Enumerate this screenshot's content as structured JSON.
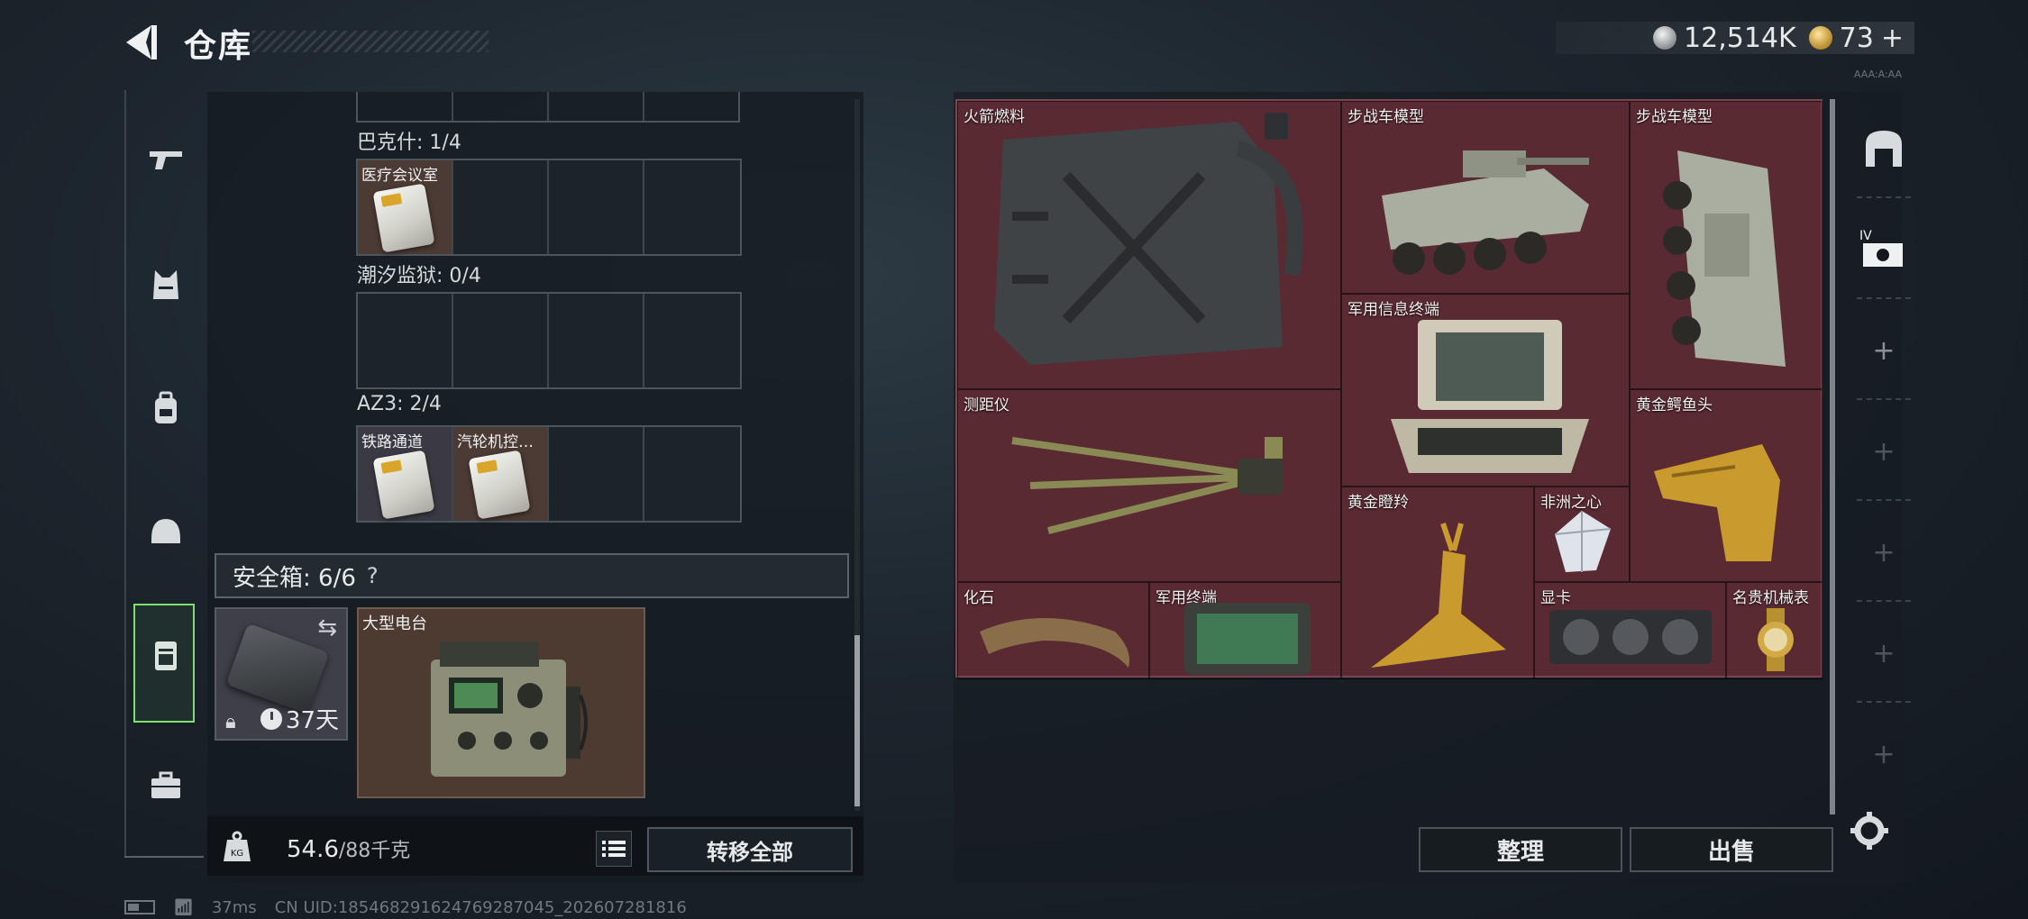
{
  "header": {
    "title": "仓库",
    "currency": {
      "silver_value": "12,514K",
      "gold_value": "73",
      "add_symbol": "+"
    },
    "tiny_code": "AAA:A:AA"
  },
  "left_rail": {
    "items": [
      {
        "name": "weapons",
        "icon": "pistol-icon"
      },
      {
        "name": "armor",
        "icon": "vest-icon"
      },
      {
        "name": "backpack",
        "icon": "backpack-icon"
      },
      {
        "name": "helmet",
        "icon": "helmet-icon"
      },
      {
        "name": "safe-case",
        "icon": "safe-case-icon",
        "active": true
      },
      {
        "name": "toolkit",
        "icon": "briefcase-icon"
      }
    ]
  },
  "keycard_sections": [
    {
      "label": "巴克什: 1/4",
      "cells": [
        "医疗会议室",
        "",
        "",
        ""
      ]
    },
    {
      "label": "潮汐监狱: 0/4",
      "cells": [
        "",
        "",
        "",
        ""
      ]
    },
    {
      "label": "AZ3: 2/4",
      "cells": [
        "铁路通道",
        "汽轮机控…",
        "",
        ""
      ]
    }
  ],
  "safe_box": {
    "header": "安全箱: 6/6",
    "help": "?",
    "swap_icon": "swap-icon",
    "lock_icon": "lock-icon",
    "timer": "37天",
    "stored_item": "大型电台"
  },
  "weight": {
    "current": "54.6",
    "max": "/88千克",
    "icon": "kg-weight-icon"
  },
  "buttons": {
    "transfer_all": "转移全部",
    "sort": "整理",
    "sell": "出售"
  },
  "storage_items": [
    {
      "label": "火箭燃料"
    },
    {
      "label": "步战车模型"
    },
    {
      "label": "步战车模型"
    },
    {
      "label": "军用信息终端"
    },
    {
      "label": "测距仪"
    },
    {
      "label": "黄金鳄鱼头"
    },
    {
      "label": "黄金瞪羚"
    },
    {
      "label": "非洲之心"
    },
    {
      "label": "化石"
    },
    {
      "label": "军用终端"
    },
    {
      "label": "显卡"
    },
    {
      "label": "名贵机械表"
    }
  ],
  "side_tabs": [
    {
      "icon": "vault-door-icon"
    },
    {
      "icon": "cash-register-icon",
      "badge": "IV"
    },
    {
      "icon": "plus-icon",
      "text": "+"
    },
    {
      "icon": "plus-icon",
      "text": "+"
    },
    {
      "icon": "plus-icon",
      "text": "+"
    },
    {
      "icon": "plus-icon",
      "text": "+"
    },
    {
      "icon": "plus-icon",
      "text": "+"
    }
  ],
  "status_bar": {
    "ping": "37ms",
    "uid": "CN UID:18546829162476928704​5_202607281816"
  },
  "colors": {
    "active_tab": "#7ee06a",
    "storage_bg": "#5a2a32",
    "card_bg": "#3b3a44"
  }
}
